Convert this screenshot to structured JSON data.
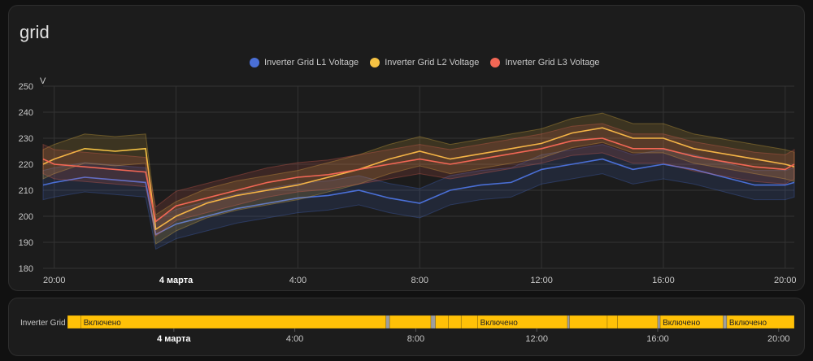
{
  "card_title": "grid",
  "chart_data": {
    "type": "line",
    "ylabel": "V",
    "ylim": [
      180,
      250
    ],
    "yticks": [
      180,
      190,
      200,
      210,
      220,
      230,
      240,
      250
    ],
    "xlim": [
      "19:38",
      "20:18"
    ],
    "xticks": [
      {
        "t": "20:00",
        "label": "20:00"
      },
      {
        "t": "00:00",
        "label": "4 марта",
        "bold": true
      },
      {
        "t": "04:00",
        "label": "4:00"
      },
      {
        "t": "08:00",
        "label": "8:00"
      },
      {
        "t": "12:00",
        "label": "12:00"
      },
      {
        "t": "16:00",
        "label": "16:00"
      },
      {
        "t": "20:00",
        "label": "20:00"
      }
    ],
    "grid": true,
    "legend_position": "top",
    "x": [
      "19:38",
      "20:00",
      "21:00",
      "22:00",
      "23:00",
      "23:20",
      "00:00",
      "01:00",
      "02:00",
      "03:00",
      "04:00",
      "05:00",
      "06:00",
      "07:00",
      "08:00",
      "09:00",
      "10:00",
      "11:00",
      "12:00",
      "13:00",
      "14:00",
      "15:00",
      "16:00",
      "17:00",
      "18:00",
      "19:00",
      "20:00",
      "20:18"
    ],
    "series": [
      {
        "name": "Inverter Grid L1 Voltage",
        "color": "#4a6fd6",
        "values": [
          212,
          213,
          215,
          214,
          213,
          193,
          197,
          200,
          203,
          205,
          207,
          208,
          210,
          207,
          205,
          210,
          212,
          213,
          218,
          220,
          222,
          218,
          220,
          218,
          215,
          212,
          212,
          213
        ]
      },
      {
        "name": "Inverter Grid L2 Voltage",
        "color": "#f5c243",
        "values": [
          220,
          222,
          226,
          225,
          226,
          195,
          200,
          205,
          208,
          210,
          212,
          215,
          218,
          222,
          225,
          222,
          224,
          226,
          228,
          232,
          234,
          230,
          230,
          226,
          224,
          222,
          220,
          219
        ]
      },
      {
        "name": "Inverter Grid L3 Voltage",
        "color": "#f26755",
        "values": [
          222,
          220,
          219,
          218,
          217,
          198,
          204,
          207,
          210,
          213,
          215,
          216,
          218,
          220,
          222,
          220,
          222,
          224,
          226,
          229,
          230,
          226,
          226,
          223,
          221,
          219,
          218,
          220
        ]
      }
    ]
  },
  "timeline": {
    "entity": "Inverter Grid",
    "range": [
      "20:29",
      "20:31"
    ],
    "on_color": "#ffc107",
    "off_color": "#9e9e9e",
    "xticks": [
      {
        "t": "00:00",
        "label": "4 марта",
        "bold": true
      },
      {
        "t": "04:00",
        "label": "4:00"
      },
      {
        "t": "08:00",
        "label": "8:00"
      },
      {
        "t": "12:00",
        "label": "12:00"
      },
      {
        "t": "16:00",
        "label": "16:00"
      },
      {
        "t": "20:00",
        "label": "20:00"
      }
    ],
    "segments": [
      {
        "from": "20:29",
        "to": "20:56",
        "state": "on",
        "label": ""
      },
      {
        "from": "20:56",
        "to": "07:01",
        "state": "on",
        "label": "Включено"
      },
      {
        "from": "07:01",
        "to": "07:08",
        "state": "unavailable",
        "label": ""
      },
      {
        "from": "07:08",
        "to": "08:30",
        "state": "on",
        "label": ""
      },
      {
        "from": "08:30",
        "to": "08:39",
        "state": "unavailable",
        "label": ""
      },
      {
        "from": "08:39",
        "to": "09:05",
        "state": "on",
        "label": ""
      },
      {
        "from": "09:05",
        "to": "09:30",
        "state": "on",
        "label": ""
      },
      {
        "from": "09:30",
        "to": "10:03",
        "state": "on",
        "label": ""
      },
      {
        "from": "10:03",
        "to": "13:01",
        "state": "on",
        "label": "Включено"
      },
      {
        "from": "13:01",
        "to": "13:05",
        "state": "unavailable",
        "label": ""
      },
      {
        "from": "13:05",
        "to": "14:20",
        "state": "on",
        "label": ""
      },
      {
        "from": "14:20",
        "to": "14:40",
        "state": "on",
        "label": ""
      },
      {
        "from": "14:40",
        "to": "16:00",
        "state": "on",
        "label": ""
      },
      {
        "from": "16:00",
        "to": "16:05",
        "state": "unavailable",
        "label": ""
      },
      {
        "from": "16:05",
        "to": "18:10",
        "state": "on",
        "label": "Включено"
      },
      {
        "from": "18:10",
        "to": "18:17",
        "state": "unavailable",
        "label": ""
      },
      {
        "from": "18:17",
        "to": "20:31",
        "state": "on",
        "label": "Включено"
      }
    ]
  }
}
